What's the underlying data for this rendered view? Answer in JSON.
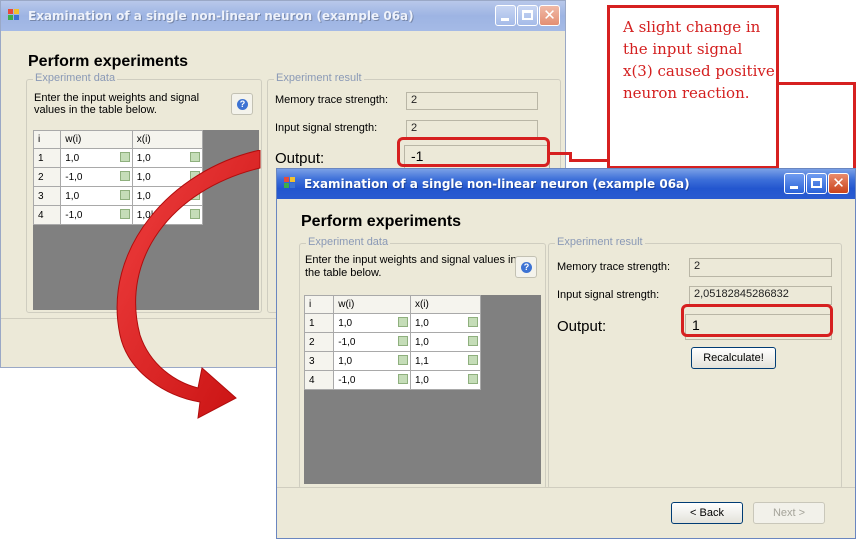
{
  "callout": {
    "text": "A slight change in the input signal x(3) caused positive neuron reaction."
  },
  "window_before": {
    "title": "Examination of a single non-linear neuron (example 06a)",
    "heading": "Perform experiments",
    "experiment_data": {
      "legend": "Experiment data",
      "instructions": "Enter the input weights and signal values in the table below.",
      "table": {
        "headers": [
          "i",
          "w(i)",
          "x(i)"
        ],
        "rows": [
          {
            "i": "1",
            "w": "1,0",
            "x": "1,0"
          },
          {
            "i": "2",
            "w": "-1,0",
            "x": "1,0"
          },
          {
            "i": "3",
            "w": "1,0",
            "x": "1,0"
          },
          {
            "i": "4",
            "w": "-1,0",
            "x": "1,0|"
          }
        ]
      }
    },
    "experiment_result": {
      "legend": "Experiment result",
      "memory_trace_label": "Memory trace strength:",
      "memory_trace_value": "2",
      "input_signal_label": "Input signal strength:",
      "input_signal_value": "2",
      "output_label": "Output:",
      "output_value": "-1"
    }
  },
  "window_after": {
    "title": "Examination of a single non-linear neuron (example 06a)",
    "heading": "Perform experiments",
    "experiment_data": {
      "legend": "Experiment data",
      "instructions": "Enter the input weights and signal values in the table below.",
      "table": {
        "headers": [
          "i",
          "w(i)",
          "x(i)"
        ],
        "rows": [
          {
            "i": "1",
            "w": "1,0",
            "x": "1,0"
          },
          {
            "i": "2",
            "w": "-1,0",
            "x": "1,0"
          },
          {
            "i": "3",
            "w": "1,0",
            "x": "1,1"
          },
          {
            "i": "4",
            "w": "-1,0",
            "x": "1,0"
          }
        ]
      }
    },
    "experiment_result": {
      "legend": "Experiment result",
      "memory_trace_label": "Memory trace strength:",
      "memory_trace_value": "2",
      "input_signal_label": "Input signal strength:",
      "input_signal_value": "2,05182845286832",
      "output_label": "Output:",
      "output_value": "1",
      "recalculate_label": "Recalculate!"
    },
    "back_label": "< Back",
    "next_label": "Next >"
  },
  "colors": {
    "highlight": "#d62020",
    "titlebar_active": "#2356cf",
    "titlebar_inactive": "#a5bae6",
    "dialog_bg": "#ece9d8"
  },
  "icons": [
    "app-icon",
    "minimize-icon",
    "maximize-icon",
    "close-icon",
    "help-icon",
    "spin-icon",
    "curved-arrow-icon"
  ]
}
